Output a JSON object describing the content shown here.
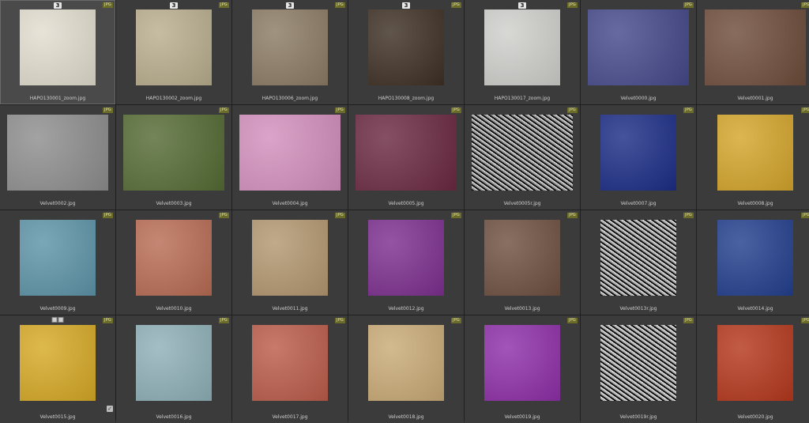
{
  "badge_type": "JPG",
  "items": [
    {
      "filename": "HAPO130001_zoom.jpg",
      "count": "3",
      "color": "#e2ddcf",
      "wide": false,
      "selected": true
    },
    {
      "filename": "HAPO130002_zoom.jpg",
      "count": "3",
      "color": "#b9ae8e",
      "wide": false
    },
    {
      "filename": "HAPO130006_zoom.jpg",
      "count": "3",
      "color": "#8b7b63",
      "wide": false
    },
    {
      "filename": "HAPO130008_zoom.jpg",
      "count": "3",
      "color": "#3e3024",
      "wide": false
    },
    {
      "filename": "HAPO130017_zoom.jpg",
      "count": "3",
      "color": "#cfd0cc",
      "wide": false
    },
    {
      "filename": "Velvet0000.jpg",
      "color": "#45498a",
      "wide": true
    },
    {
      "filename": "Velvet0001.jpg",
      "color": "#6e4c3a",
      "wide": true
    },
    {
      "filename": "Velvet0002.jpg",
      "color": "#8e8e8e",
      "wide": true
    },
    {
      "filename": "Velvet0003.jpg",
      "color": "#556b34",
      "wide": true
    },
    {
      "filename": "Velvet0004.jpg",
      "color": "#d38fbd",
      "wide": true
    },
    {
      "filename": "Velvet0005.jpg",
      "color": "#6b2941",
      "wide": true
    },
    {
      "filename": "Velvet0005r.jpg",
      "color": "#9a9a9a",
      "wide": true,
      "noise": true
    },
    {
      "filename": "Velvet0007.jpg",
      "color": "#1c2d86",
      "wide": false
    },
    {
      "filename": "Velvet0008.jpg",
      "color": "#d4a52b",
      "wide": false
    },
    {
      "filename": "Velvet0009.jpg",
      "color": "#5d94a8",
      "wide": false
    },
    {
      "filename": "Velvet0010.jpg",
      "color": "#b86c54",
      "wide": false
    },
    {
      "filename": "Velvet0011.jpg",
      "color": "#b39770",
      "wide": false
    },
    {
      "filename": "Velvet0012.jpg",
      "color": "#7d2f8f",
      "wide": false
    },
    {
      "filename": "Velvet0013.jpg",
      "color": "#6e5040",
      "wide": false
    },
    {
      "filename": "Velvet0013r.jpg",
      "color": "#aaaaaa",
      "wide": false,
      "noise": true
    },
    {
      "filename": "Velvet0014.jpg",
      "color": "#233f8d",
      "wide": false
    },
    {
      "filename": "Velvet0015.jpg",
      "color": "#d6a925",
      "wide": false,
      "overlay": true,
      "check": true
    },
    {
      "filename": "Velvet0016.jpg",
      "color": "#8fb0b8",
      "wide": false
    },
    {
      "filename": "Velvet0017.jpg",
      "color": "#bb5c4a",
      "wide": false
    },
    {
      "filename": "Velvet0018.jpg",
      "color": "#c9aa76",
      "wide": false
    },
    {
      "filename": "Velvet0019.jpg",
      "color": "#8e2fa8",
      "wide": false
    },
    {
      "filename": "Velvet0019r.jpg",
      "color": "#b0b0b0",
      "wide": false,
      "noise": true
    },
    {
      "filename": "Velvet0020.jpg",
      "color": "#b5381c",
      "wide": false
    }
  ]
}
